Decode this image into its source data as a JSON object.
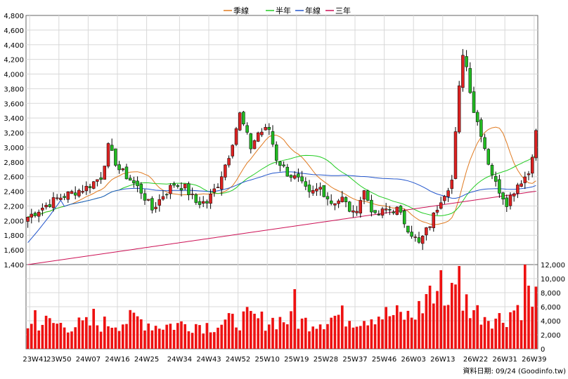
{
  "chart_data": {
    "type": "candlestick",
    "legend": [
      {
        "name": "季線",
        "color": "#e07a20"
      },
      {
        "name": "半年",
        "color": "#22cc22"
      },
      {
        "name": "年線",
        "color": "#2255cc"
      },
      {
        "name": "三年",
        "color": "#cc1155"
      }
    ],
    "price_axis": {
      "min": 1400,
      "max": 4800,
      "ticks": [
        "1,400",
        "1,600",
        "1,800",
        "2,000",
        "2,200",
        "2,400",
        "2,600",
        "2,800",
        "3,000",
        "3,200",
        "3,400",
        "3,600",
        "3,800",
        "4,000",
        "4,200",
        "4,400",
        "4,600",
        "4,800"
      ]
    },
    "volume_axis": {
      "min": 0,
      "max": 12000,
      "ticks": [
        "0",
        "2,000",
        "4,000",
        "6,000",
        "8,000",
        "10,000",
        "12,000"
      ]
    },
    "x_labels": [
      "23W41",
      "23W50",
      "24W07",
      "24W16",
      "24W25",
      "24W34",
      "24W43",
      "24W52",
      "25W10",
      "25W19",
      "25W28",
      "25W37",
      "25W46",
      "26W03",
      "26W13",
      "26W22",
      "26W31",
      "26W39"
    ],
    "close_anchors": [
      [
        0,
        2050
      ],
      [
        4,
        2180
      ],
      [
        8,
        2300
      ],
      [
        12,
        2380
      ],
      [
        16,
        2450
      ],
      [
        20,
        2600
      ],
      [
        22,
        3000
      ],
      [
        25,
        2700
      ],
      [
        28,
        2560
      ],
      [
        31,
        2400
      ],
      [
        34,
        2150
      ],
      [
        37,
        2350
      ],
      [
        40,
        2500
      ],
      [
        43,
        2450
      ],
      [
        46,
        2250
      ],
      [
        49,
        2250
      ],
      [
        52,
        2500
      ],
      [
        55,
        2900
      ],
      [
        58,
        3450
      ],
      [
        61,
        3000
      ],
      [
        63,
        3200
      ],
      [
        66,
        3250
      ],
      [
        68,
        2850
      ],
      [
        71,
        2650
      ],
      [
        74,
        2550
      ],
      [
        77,
        2350
      ],
      [
        80,
        2450
      ],
      [
        83,
        2250
      ],
      [
        86,
        2300
      ],
      [
        89,
        2080
      ],
      [
        92,
        2400
      ],
      [
        95,
        2050
      ],
      [
        98,
        2150
      ],
      [
        101,
        2150
      ],
      [
        104,
        1900
      ],
      [
        107,
        1680
      ],
      [
        110,
        1950
      ],
      [
        113,
        2300
      ],
      [
        116,
        2550
      ],
      [
        118,
        3800
      ],
      [
        119,
        4300
      ],
      [
        120,
        4100
      ],
      [
        122,
        3500
      ],
      [
        124,
        3200
      ],
      [
        126,
        2800
      ],
      [
        128,
        2500
      ],
      [
        131,
        2250
      ],
      [
        134,
        2500
      ],
      [
        137,
        2650
      ],
      [
        139,
        3200
      ]
    ],
    "volume_anchors": [
      [
        0,
        3500
      ],
      [
        5,
        4000
      ],
      [
        10,
        3500
      ],
      [
        15,
        3600
      ],
      [
        20,
        3700
      ],
      [
        25,
        4000
      ],
      [
        30,
        4500
      ],
      [
        35,
        3500
      ],
      [
        40,
        3600
      ],
      [
        45,
        3800
      ],
      [
        50,
        3500
      ],
      [
        55,
        4000
      ],
      [
        60,
        4600
      ],
      [
        65,
        4200
      ],
      [
        70,
        4400
      ],
      [
        75,
        4000
      ],
      [
        80,
        4200
      ],
      [
        85,
        5000
      ],
      [
        90,
        4500
      ],
      [
        95,
        5200
      ],
      [
        100,
        5000
      ],
      [
        105,
        4800
      ],
      [
        108,
        6500
      ],
      [
        111,
        7000
      ],
      [
        114,
        6500
      ],
      [
        117,
        8000
      ],
      [
        120,
        7000
      ],
      [
        123,
        5500
      ],
      [
        127,
        4800
      ],
      [
        130,
        4500
      ],
      [
        133,
        6000
      ],
      [
        136,
        7000
      ],
      [
        138,
        9000
      ],
      [
        139,
        7800
      ]
    ],
    "volume_spikes": [
      [
        2,
        5500
      ],
      [
        18,
        5700
      ],
      [
        73,
        8500
      ],
      [
        101,
        6200
      ],
      [
        109,
        7800
      ],
      [
        110,
        9000
      ],
      [
        113,
        11200
      ],
      [
        116,
        9400
      ],
      [
        118,
        11800
      ],
      [
        136,
        12800
      ],
      [
        137,
        9000
      ],
      [
        138,
        6000
      ]
    ],
    "n_bars": 140
  },
  "footer": {
    "source": "資料日期: 09/24  (Goodinfo.tw)"
  }
}
